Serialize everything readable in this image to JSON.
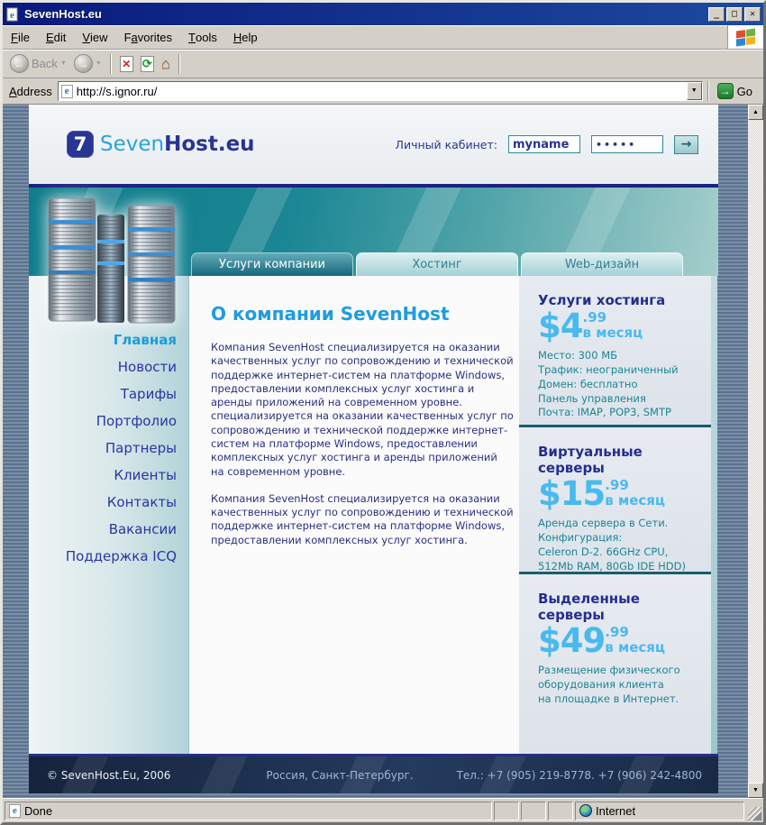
{
  "browser": {
    "title": "SevenHost.eu",
    "menu": [
      {
        "pre": "",
        "u": "F",
        "rest": "ile"
      },
      {
        "pre": "",
        "u": "E",
        "rest": "dit"
      },
      {
        "pre": "",
        "u": "V",
        "rest": "iew"
      },
      {
        "pre": "F",
        "u": "a",
        "rest": "vorites"
      },
      {
        "pre": "",
        "u": "T",
        "rest": "ools"
      },
      {
        "pre": "",
        "u": "H",
        "rest": "elp"
      }
    ],
    "back_label": "Back",
    "address": {
      "pre": "",
      "u": "A",
      "rest": "ddress"
    },
    "address_value": "http://s.ignor.ru/",
    "go_label": "Go",
    "status_left": "Done",
    "status_right": "Internet"
  },
  "icons": {
    "minimize": "_",
    "maximize": "□",
    "close": "✕",
    "back_arrow": "←",
    "forward_arrow": "→",
    "dropdown": "▼",
    "stop": "✕",
    "refresh": "⟳",
    "home": "⌂",
    "go_arrow": "→",
    "login_arrow": "→",
    "scroll_up": "▲",
    "scroll_down": "▼",
    "ie_letter": "e"
  },
  "colors": {
    "titlebar": "#0a1a7e",
    "teal": "#16677a",
    "accent_blue": "#1e9ce0",
    "navy": "#283593",
    "chrome_gray": "#d4d0c8"
  },
  "site": {
    "logo": {
      "symbol": "7",
      "part1": "Seven",
      "part2": "Host.eu"
    },
    "login": {
      "label": "Личный кабинет:",
      "username": "myname",
      "password": "•••••"
    },
    "tabs": [
      {
        "label": "Услуги компании",
        "active": true
      },
      {
        "label": "Хостинг",
        "active": false
      },
      {
        "label": "Web-дизайн",
        "active": false
      }
    ],
    "menu": [
      {
        "label": "Главная",
        "active": true
      },
      {
        "label": "Новости",
        "active": false
      },
      {
        "label": "Тарифы",
        "active": false
      },
      {
        "label": "Портфолио",
        "active": false
      },
      {
        "label": "Партнеры",
        "active": false
      },
      {
        "label": "Клиенты",
        "active": false
      },
      {
        "label": "Контакты",
        "active": false
      },
      {
        "label": "Вакансии",
        "active": false
      },
      {
        "label": "Поддержка ICQ",
        "active": false
      }
    ],
    "main": {
      "heading": "О компании SevenHost",
      "paragraphs": [
        "Компания SevenHost специализируется на оказании качественных услуг по сопровождению и технической поддержке интернет-систем на платформе Windows, предоставлении комплексных услуг хостинга и аренды приложений на современном уровне.  специализируется на оказании качественных услуг по сопровождению и технической поддержке интернет-систем на платформе Windows, предоставлении комплексных услуг хостинга и аренды приложений на современном уровне.",
        "Компания SevenHost специализируется на оказании качественных услуг по сопровождению и технической поддержке интернет-систем на платформе Windows, предоставлении комплексных услуг хостинга."
      ]
    },
    "offers": [
      {
        "title": "Услуги хостинга",
        "dollars": "$4",
        "cents": ".99",
        "per": "в месяц",
        "lines": [
          "Место: 300 МБ",
          "Трафик: неограниченный",
          "Домен: бесплатно",
          "Панель управления",
          "Почта: IMAP, POP3, SMTP"
        ]
      },
      {
        "title": "Виртуальные серверы",
        "dollars": "$15",
        "cents": ".99",
        "per": "в месяц",
        "lines": [
          "Аренда сервера в Сети.",
          "Конфигурация:",
          "Celeron D-2. 66GHz CPU,",
          "512Mb RAM, 80Gb IDE HDD)"
        ]
      },
      {
        "title": "Выделенные серверы",
        "dollars": "$49",
        "cents": ".99",
        "per": "в месяц",
        "lines": [
          "Размещение физического",
          "оборудования клиента",
          "на площадке в Интернет."
        ]
      }
    ],
    "footer": {
      "copyright": "© SevenHost.Eu, 2006",
      "location": "Россия, Санкт-Петербург.",
      "phones": "Тел.: +7 (905) 219-8778.  +7 (906) 242-4800"
    }
  }
}
